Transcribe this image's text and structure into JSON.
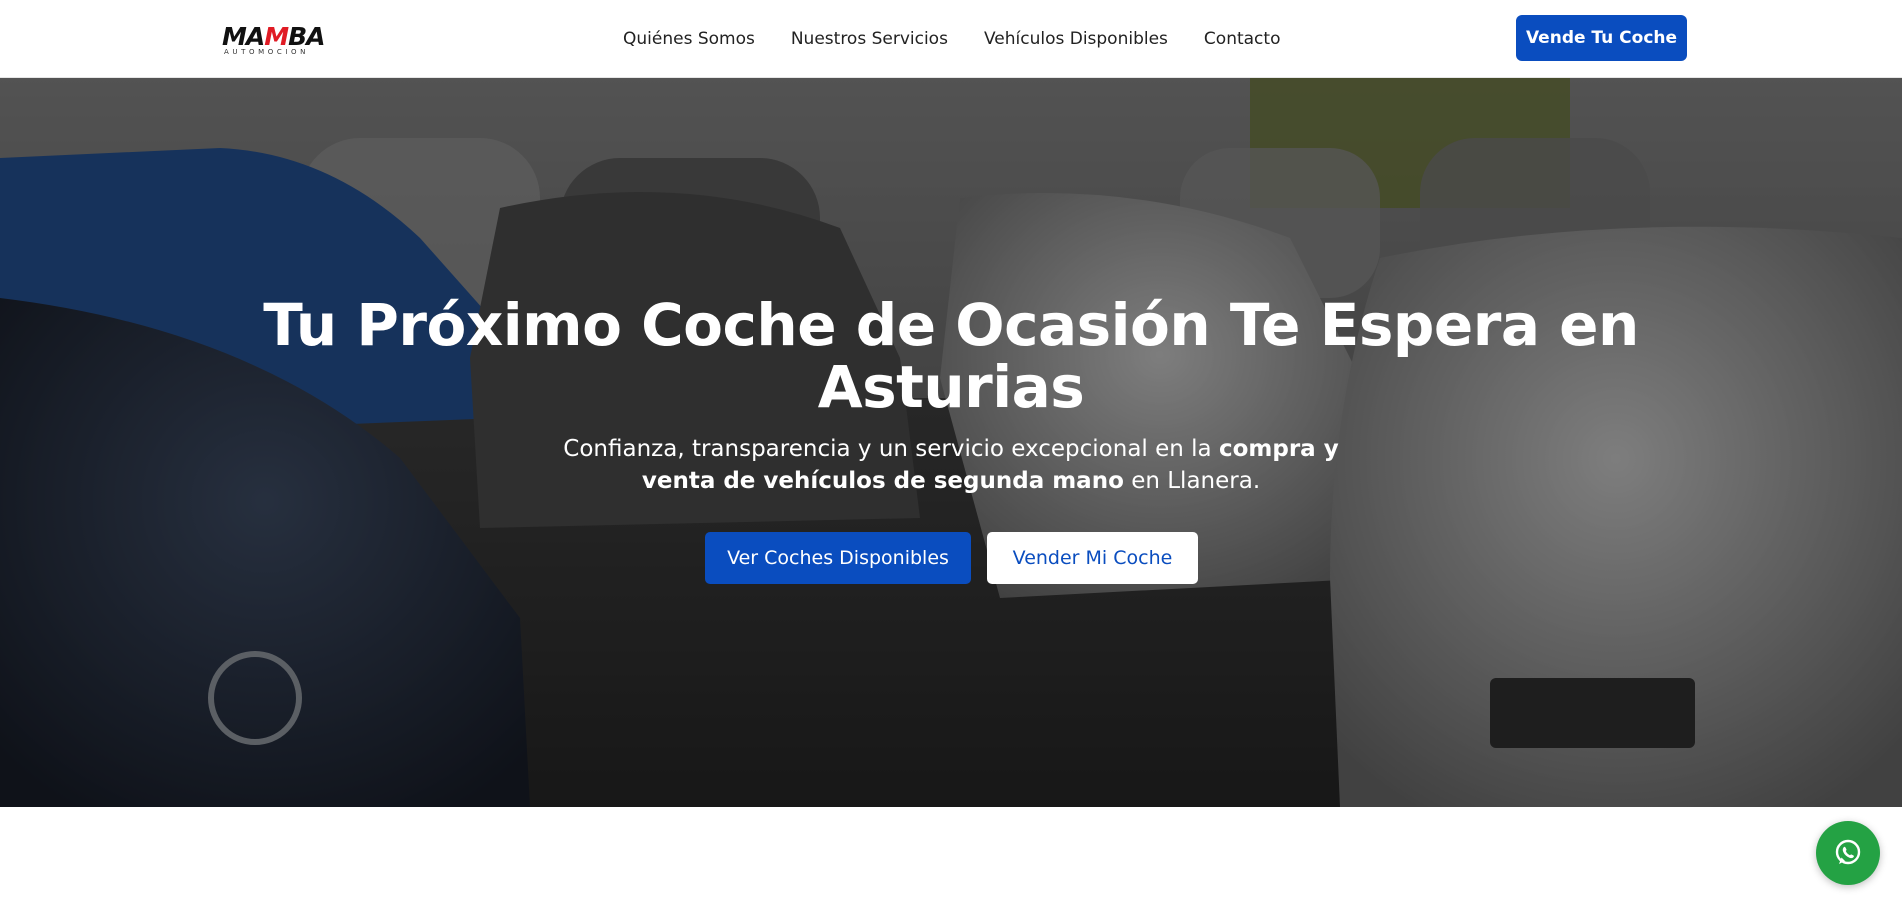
{
  "brand": {
    "logo_prefix": "MA",
    "logo_accent": "M",
    "logo_suffix": "BA",
    "logo_sub": "AUTOMOCION",
    "accent_color": "#e01b24"
  },
  "nav": {
    "items": [
      {
        "label": "Quiénes Somos"
      },
      {
        "label": "Nuestros Servicios"
      },
      {
        "label": "Vehículos Disponibles"
      },
      {
        "label": "Contacto"
      }
    ],
    "cta_label": "Vende Tu Coche"
  },
  "hero": {
    "title": "Tu Próximo Coche de Ocasión Te Espera en Asturias",
    "subtitle_part1": "Confianza, transparencia y un servicio excepcional en la ",
    "subtitle_bold": "compra y venta de vehículos de segunda mano",
    "subtitle_part2": " en Llanera.",
    "primary_button": "Ver Coches Disponibles",
    "secondary_button": "Vender Mi Coche",
    "background_image": "showroom-cars-photo"
  },
  "floating": {
    "whatsapp_icon": "whatsapp-icon"
  },
  "colors": {
    "primary_blue": "#0a4dbf",
    "whatsapp_green": "#24a244",
    "white": "#ffffff"
  }
}
